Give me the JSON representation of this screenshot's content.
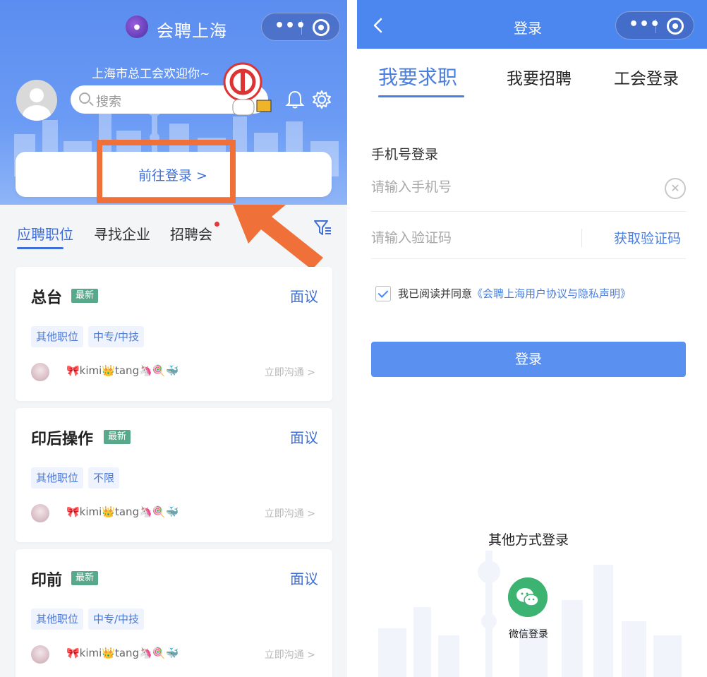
{
  "left": {
    "app_title": "会聘上海",
    "welcome": "上海市总工会欢迎你~",
    "search_placeholder": "搜索",
    "login_link": "前往登录 >",
    "tabs": [
      "应聘职位",
      "寻找企业",
      "招聘会"
    ],
    "jobs": [
      {
        "title": "总台",
        "badge": "最新",
        "salary": "面议",
        "tags": [
          "其他职位",
          "中专/中技"
        ],
        "recruiter": "🎀kimi👑tang🦄🍭🐳",
        "chat": "立即沟通 >"
      },
      {
        "title": "印后操作",
        "badge": "最新",
        "salary": "面议",
        "tags": [
          "其他职位",
          "不限"
        ],
        "recruiter": "🎀kimi👑tang🦄🍭🐳",
        "chat": "立即沟通 >"
      },
      {
        "title": "印前",
        "badge": "最新",
        "salary": "面议",
        "tags": [
          "其他职位",
          "中专/中技"
        ],
        "recruiter": "🎀kimi👑tang🦄🍭🐳",
        "chat": "立即沟通 >"
      }
    ],
    "accent": "#3f6fd8",
    "annotation_color": "#f0703a"
  },
  "right": {
    "nav_title": "登录",
    "tabs": [
      "我要求职",
      "我要招聘",
      "工会登录"
    ],
    "phone_heading": "手机号登录",
    "phone_placeholder": "请输入手机号",
    "code_placeholder": "请输入验证码",
    "get_code": "获取验证码",
    "agree_text": "我已阅读并同意",
    "agree_link": "《会聘上海用户协议与隐私声明》",
    "login_button": "登录",
    "other_login": "其他方式登录",
    "wechat_label": "微信登录",
    "primary_color": "#4c86ef"
  }
}
